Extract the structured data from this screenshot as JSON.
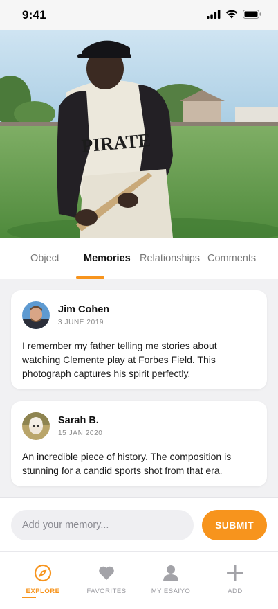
{
  "status_bar": {
    "time": "9:41"
  },
  "hero": {
    "subject": "vintage baseball player photo",
    "jersey_text": "PIRATE"
  },
  "tabs": [
    {
      "label": "Object",
      "active": false
    },
    {
      "label": "Memories",
      "active": true
    },
    {
      "label": "Relationships",
      "active": false
    },
    {
      "label": "Comments",
      "active": false
    }
  ],
  "memories": [
    {
      "author": "Jim Cohen",
      "date": "3 JUNE 2019",
      "text": "I remember my father telling me stories about watching Clemente play at Forbes Field. This photograph captures his spirit perfectly."
    },
    {
      "author": "Sarah B.",
      "date": "15 JAN 2020",
      "text": "An incredible piece of history. The composition is stunning for a candid sports shot from that era."
    }
  ],
  "composer": {
    "placeholder": "Add your memory...",
    "submit_label": "SUBMIT"
  },
  "tabbar": [
    {
      "label": "EXPLORE",
      "icon": "compass-icon",
      "active": true
    },
    {
      "label": "FAVORITES",
      "icon": "heart-icon",
      "active": false
    },
    {
      "label": "MY ESAIYO",
      "icon": "user-icon",
      "active": false
    },
    {
      "label": "ADD",
      "icon": "plus-icon",
      "active": false
    }
  ],
  "colors": {
    "accent": "#f7941d",
    "inactive": "#9a9aa0",
    "background": "#f1f1f3"
  }
}
